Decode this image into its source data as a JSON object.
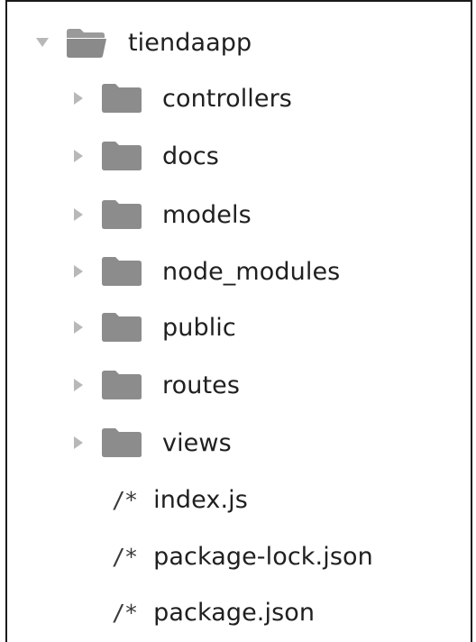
{
  "tree": {
    "root": {
      "name": "tiendaapp",
      "expanded": true
    },
    "folders": [
      {
        "name": "controllers",
        "expanded": false
      },
      {
        "name": "docs",
        "expanded": false
      },
      {
        "name": "models",
        "expanded": false
      },
      {
        "name": "node_modules",
        "expanded": false
      },
      {
        "name": "public",
        "expanded": false
      },
      {
        "name": "routes",
        "expanded": false
      },
      {
        "name": "views",
        "expanded": false
      }
    ],
    "files": [
      {
        "name": "index.js",
        "icon": "/*"
      },
      {
        "name": "package-lock.json",
        "icon": "/*"
      },
      {
        "name": "package.json",
        "icon": "/*"
      }
    ]
  },
  "colors": {
    "folder_open": "#8c8c8c",
    "folder_closed": "#8c8c8c",
    "arrow": "#b8b8b8",
    "text": "#202020"
  }
}
